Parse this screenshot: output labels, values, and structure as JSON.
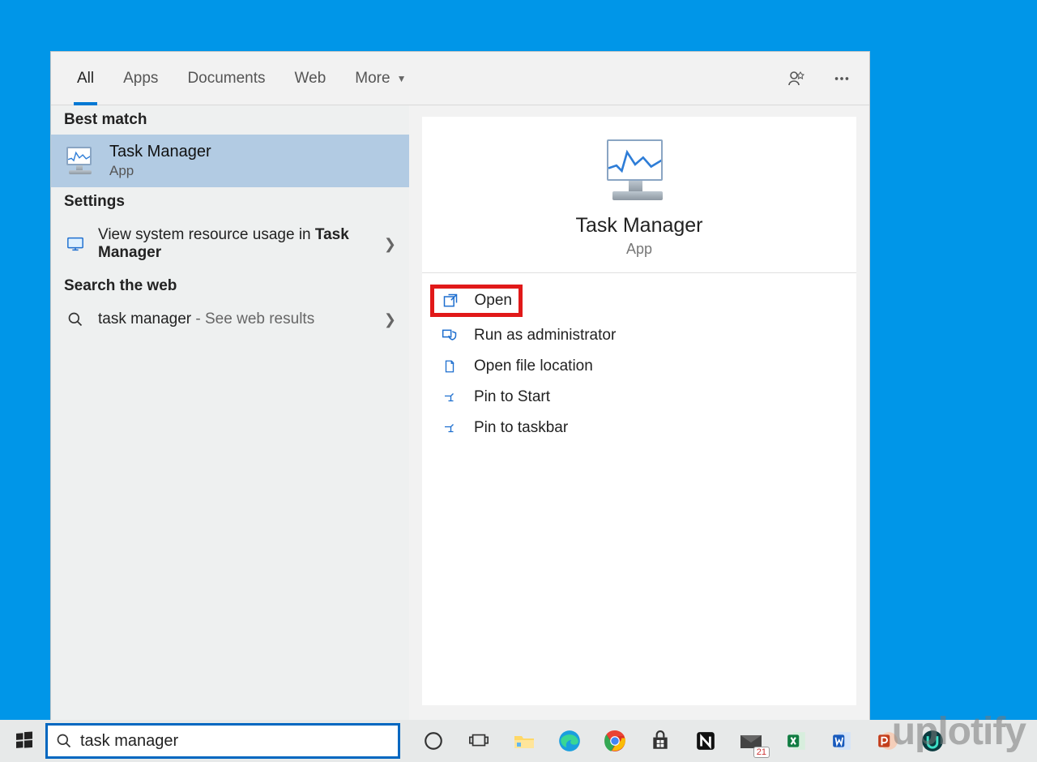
{
  "tabs": {
    "all": "All",
    "apps": "Apps",
    "documents": "Documents",
    "web": "Web",
    "more": "More"
  },
  "sections": {
    "best_match": "Best match",
    "settings": "Settings",
    "search_web": "Search the web"
  },
  "best_match_item": {
    "title": "Task Manager",
    "subtitle": "App"
  },
  "settings_item": {
    "prefix": "View system resource usage in ",
    "bold": "Task Manager"
  },
  "web_item": {
    "query": "task manager",
    "suffix": " - See web results"
  },
  "right": {
    "title": "Task Manager",
    "subtitle": "App"
  },
  "actions": {
    "open": "Open",
    "run_admin": "Run as administrator",
    "open_loc": "Open file location",
    "pin_start": "Pin to Start",
    "pin_taskbar": "Pin to taskbar"
  },
  "search_input": "task manager",
  "taskbar_icons": [
    "cortana",
    "task-view",
    "file-explorer",
    "edge",
    "chrome",
    "store",
    "notion",
    "mail",
    "excel",
    "word",
    "powerpoint",
    "app-u"
  ],
  "calendar_badge": "21",
  "watermark": "uplotify"
}
